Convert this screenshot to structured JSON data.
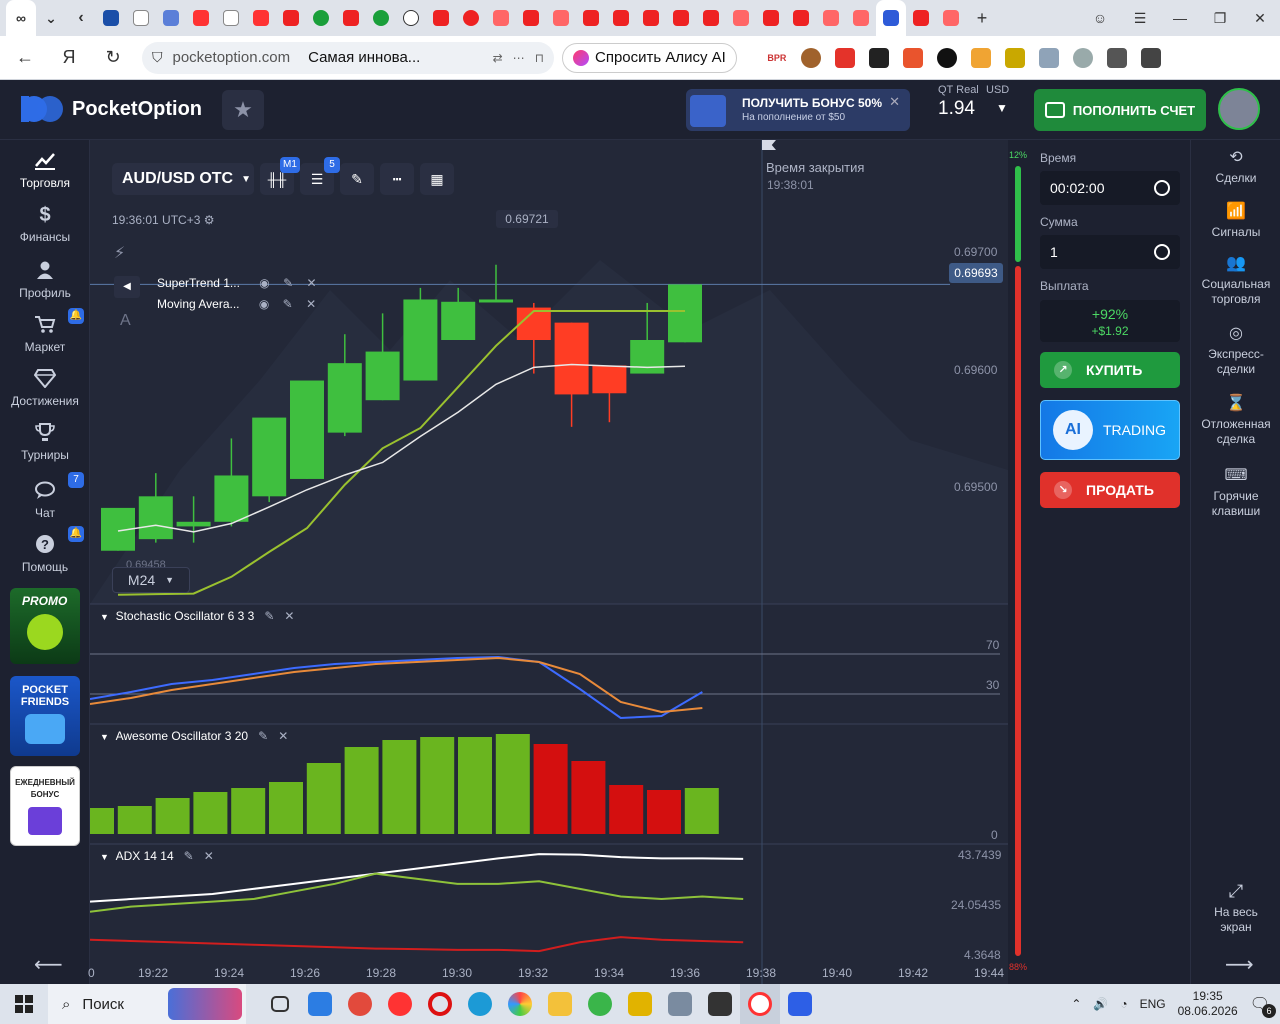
{
  "browser": {
    "url_domain": "pocketoption.com",
    "page_title": "Самая иннова...",
    "alice_label": "Спросить Алису AI"
  },
  "header": {
    "logo_text": "PocketOption",
    "bonus_title": "ПОЛУЧИТЬ БОНУС 50%",
    "bonus_subtitle": "На пополнение от $50",
    "account_type": "QT Real",
    "account_currency": "USD",
    "balance": "1.94",
    "deposit_label": "ПОПОЛНИТЬ СЧЕТ"
  },
  "left_sidebar": {
    "items": [
      {
        "label": "Торговля",
        "icon": "chart-icon"
      },
      {
        "label": "Финансы",
        "icon": "dollar-icon"
      },
      {
        "label": "Профиль",
        "icon": "user-icon"
      },
      {
        "label": "Маркет",
        "icon": "cart-icon"
      },
      {
        "label": "Достижения",
        "icon": "diamond-icon"
      },
      {
        "label": "Турниры",
        "icon": "trophy-icon"
      },
      {
        "label": "Чат",
        "icon": "chat-icon"
      },
      {
        "label": "Помощь",
        "icon": "help-icon"
      }
    ],
    "chat_badge": "7",
    "promo1": "PROMO",
    "promo2": "POCKET FRIENDS",
    "promo3": "ЕЖЕДНЕВНЫЙ БОНУС"
  },
  "chart": {
    "pair": "AUD/USD OTC",
    "timeframe_badge": "M1",
    "indicators_badge": "5",
    "clock": "19:36:01 UTC+3",
    "last_high": "0.69721",
    "current_price": "0.69693",
    "timeframe": "M24",
    "close_label": "Время закрытия",
    "close_time": "19:38:01",
    "indicator1": "SuperTrend 1...",
    "indicator2": "Moving Avera...",
    "stoch_title": "Stochastic Oscillator  6 3 3",
    "ao_title": "Awesome Oscillator  3 20",
    "adx_title": "ADX  14 14",
    "progress_top": "12%",
    "progress_bottom": "88%",
    "low_label": "0.69458",
    "stoch_levels": [
      "70",
      "30"
    ],
    "ao_zero": "0",
    "adx_levels": [
      "43.7439",
      "24.05435",
      "4.3648"
    ]
  },
  "chart_data": {
    "type": "candlestick",
    "x_ticks": [
      "0",
      "19:22",
      "19:24",
      "19:26",
      "19:28",
      "19:30",
      "19:32",
      "19:34",
      "19:36",
      "19:38",
      "19:40",
      "19:42",
      "19:44"
    ],
    "y_ticks": [
      "0.69700",
      "0.69600",
      "0.69500"
    ],
    "ylim": [
      0.69455,
      0.6974
    ],
    "candles": [
      {
        "o": 0.69463,
        "h": 0.6949,
        "l": 0.69463,
        "c": 0.695,
        "dir": "up"
      },
      {
        "o": 0.69473,
        "h": 0.6953,
        "l": 0.6947,
        "c": 0.6951,
        "dir": "up"
      },
      {
        "o": 0.69484,
        "h": 0.6951,
        "l": 0.6947,
        "c": 0.69488,
        "dir": "up"
      },
      {
        "o": 0.69488,
        "h": 0.6956,
        "l": 0.69484,
        "c": 0.69528,
        "dir": "up"
      },
      {
        "o": 0.6951,
        "h": 0.6957,
        "l": 0.69505,
        "c": 0.69578,
        "dir": "up"
      },
      {
        "o": 0.69525,
        "h": 0.69605,
        "l": 0.69525,
        "c": 0.6961,
        "dir": "up"
      },
      {
        "o": 0.69565,
        "h": 0.6965,
        "l": 0.69562,
        "c": 0.69625,
        "dir": "up"
      },
      {
        "o": 0.69593,
        "h": 0.69668,
        "l": 0.69593,
        "c": 0.69635,
        "dir": "up"
      },
      {
        "o": 0.6961,
        "h": 0.6969,
        "l": 0.6961,
        "c": 0.6968,
        "dir": "up"
      },
      {
        "o": 0.69645,
        "h": 0.6969,
        "l": 0.69645,
        "c": 0.69678,
        "dir": "up"
      },
      {
        "o": 0.6968,
        "h": 0.6971,
        "l": 0.6968,
        "c": 0.6968,
        "dir": "up"
      },
      {
        "o": 0.69673,
        "h": 0.69677,
        "l": 0.69616,
        "c": 0.69645,
        "dir": "down"
      },
      {
        "o": 0.6966,
        "h": 0.6966,
        "l": 0.6957,
        "c": 0.69598,
        "dir": "down"
      },
      {
        "o": 0.69623,
        "h": 0.69623,
        "l": 0.69574,
        "c": 0.69599,
        "dir": "down"
      },
      {
        "o": 0.69645,
        "h": 0.69677,
        "l": 0.69625,
        "c": 0.69616,
        "dir": "up"
      },
      {
        "o": 0.69693,
        "h": 0.69693,
        "l": 0.69643,
        "c": 0.69643,
        "dir": "up"
      }
    ],
    "ao_bars": [
      0.26,
      0.28,
      0.36,
      0.42,
      0.46,
      0.52,
      0.71,
      0.87,
      0.94,
      0.97,
      0.97,
      1.0,
      0.9,
      0.73,
      0.49,
      0.44,
      0.46
    ],
    "ao_colors": [
      "up",
      "up",
      "up",
      "up",
      "up",
      "up",
      "up",
      "up",
      "up",
      "up",
      "up",
      "up",
      "down",
      "down",
      "down",
      "down",
      "up"
    ]
  },
  "trade_panel": {
    "time_label": "Время",
    "time_value": "00:02:00",
    "amount_label": "Сумма",
    "amount_value": "1",
    "payout_label": "Выплата",
    "payout_pct": "+92%",
    "payout_amt": "+$1.92",
    "buy_label": "КУПИТЬ",
    "ai_label": "TRADING",
    "ai_badge": "AI",
    "sell_label": "ПРОДАТЬ"
  },
  "right_sidebar": {
    "items": [
      {
        "label": "Сделки",
        "icon": "history-icon"
      },
      {
        "label": "Сигналы",
        "icon": "signal-icon"
      },
      {
        "label": "Социальная торговля",
        "icon": "social-icon"
      },
      {
        "label": "Экспресс-сделки",
        "icon": "target-icon"
      },
      {
        "label": "Отложенная сделка",
        "icon": "hourglass-icon"
      },
      {
        "label": "Горячие клавиши",
        "icon": "keyboard-icon"
      }
    ],
    "fullscreen_label": "На весь экран"
  },
  "taskbar": {
    "search_label": "Поиск",
    "lang": "ENG",
    "time": "19:35",
    "date": "08.06.2026",
    "notif_count": "6"
  },
  "colors": {
    "up": "#3fbf3f",
    "down": "#ff3d24",
    "ao_up": "#6ab51f",
    "ao_down": "#d40f0f",
    "supertrend": "#9ac12f",
    "ma": "#e8e8e8"
  }
}
